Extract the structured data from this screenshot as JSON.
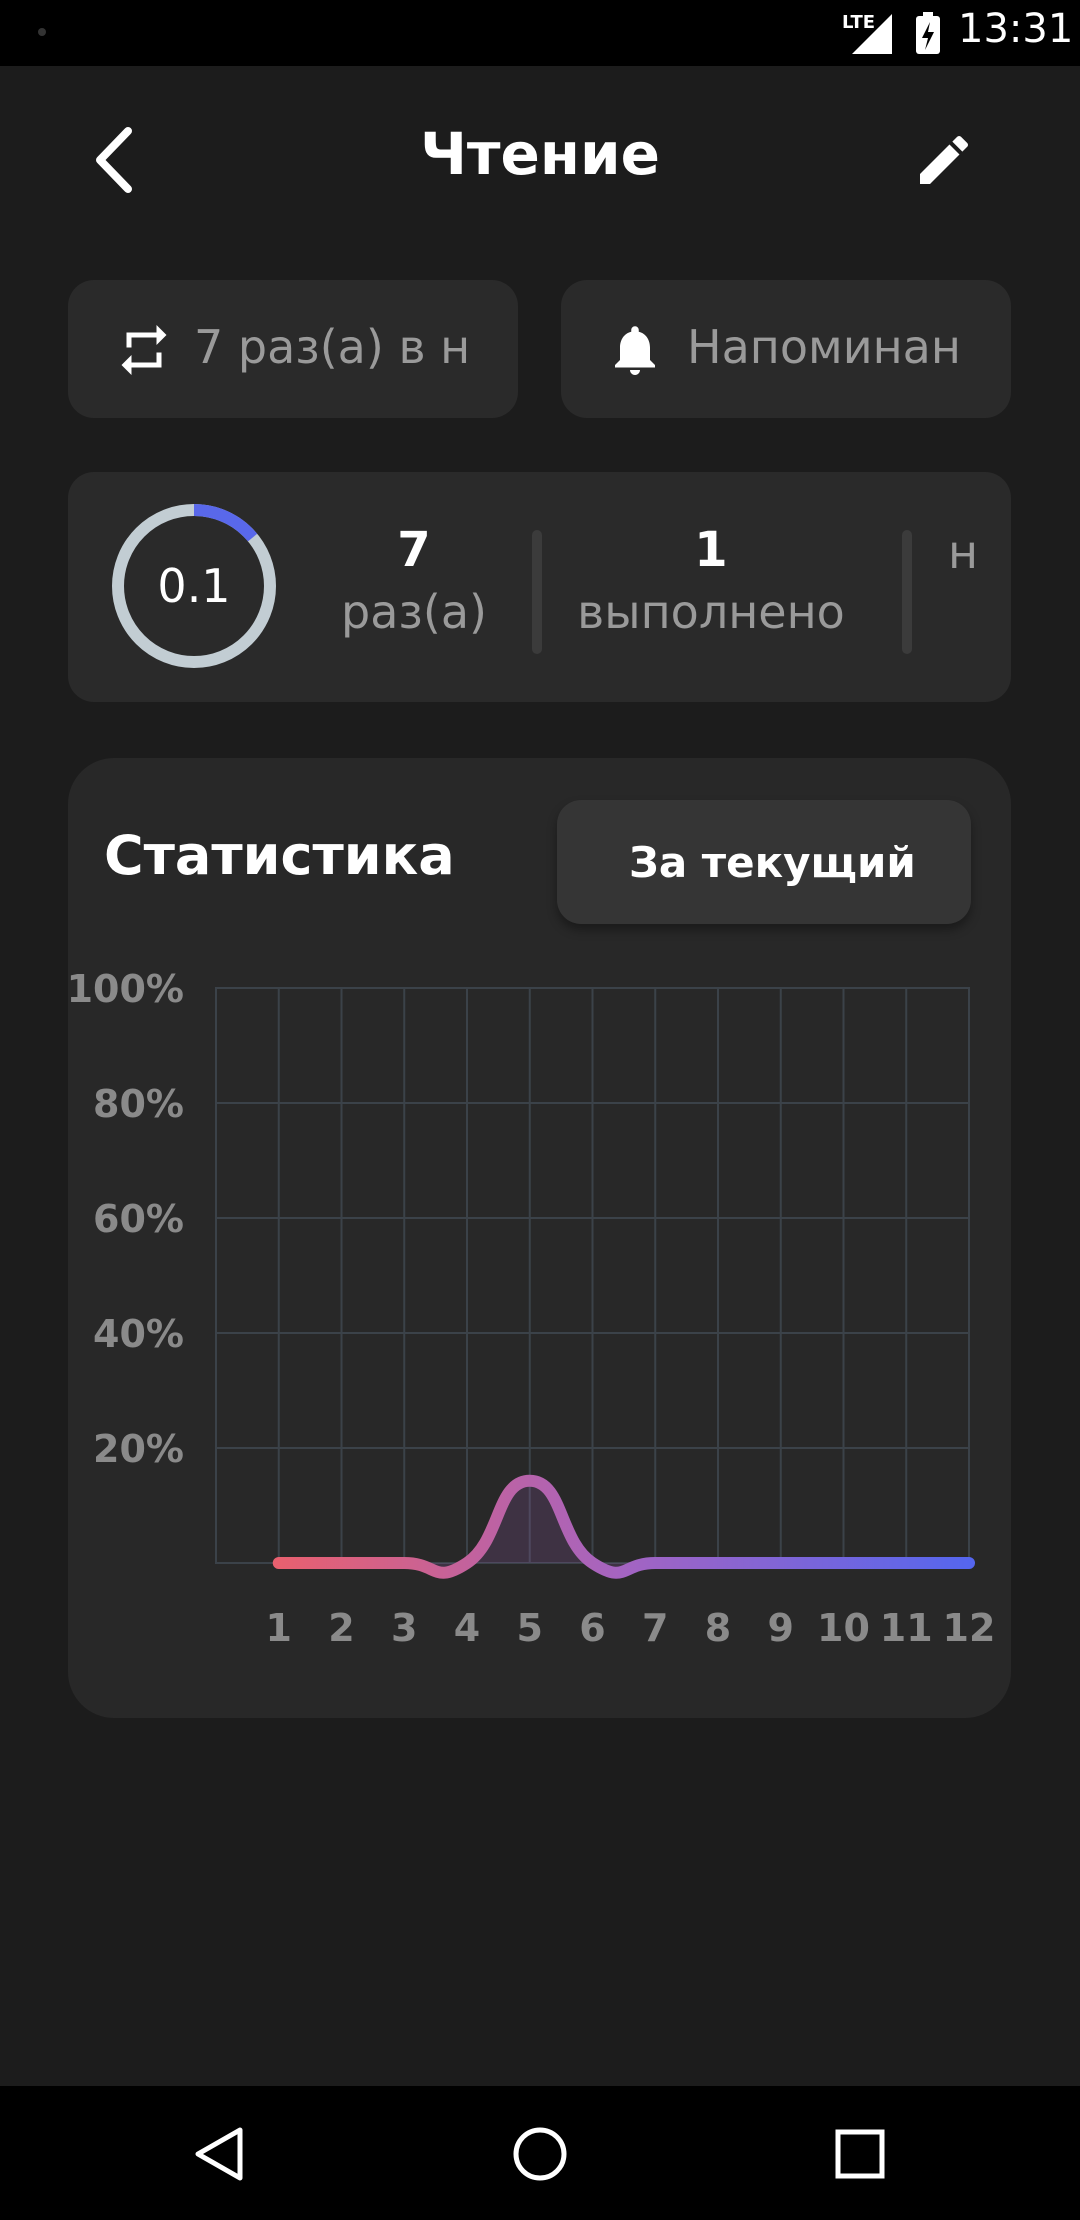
{
  "status_bar": {
    "network": "LTE",
    "time": "13:31"
  },
  "header": {
    "title": "Чтение"
  },
  "chips": {
    "frequency": "7 раз(а) в н",
    "reminder": "Напоминан"
  },
  "summary": {
    "progress_value": "0.1",
    "progress_fraction": 0.14,
    "stats": [
      {
        "number": "7",
        "label": "раз(а)"
      },
      {
        "number": "1",
        "label": "выполнено"
      },
      {
        "number": "",
        "label": "н"
      }
    ]
  },
  "statistics": {
    "title": "Статистика",
    "period_label": "За текущий го"
  },
  "chart_data": {
    "type": "line",
    "x": [
      1,
      2,
      3,
      4,
      5,
      6,
      7,
      8,
      9,
      10,
      11,
      12
    ],
    "y": [
      0,
      0,
      0,
      0,
      14.3,
      0,
      0,
      0,
      0,
      0,
      0,
      0
    ],
    "xticks": [
      "1",
      "2",
      "3",
      "4",
      "5",
      "6",
      "7",
      "8",
      "9",
      "10",
      "11",
      "12"
    ],
    "yticks": [
      "20%",
      "40%",
      "60%",
      "80%",
      "100%"
    ],
    "ylim": [
      0,
      100
    ],
    "grid": true,
    "gradient_colors": [
      "#e8606f",
      "#a464c2",
      "#5566ee"
    ]
  }
}
